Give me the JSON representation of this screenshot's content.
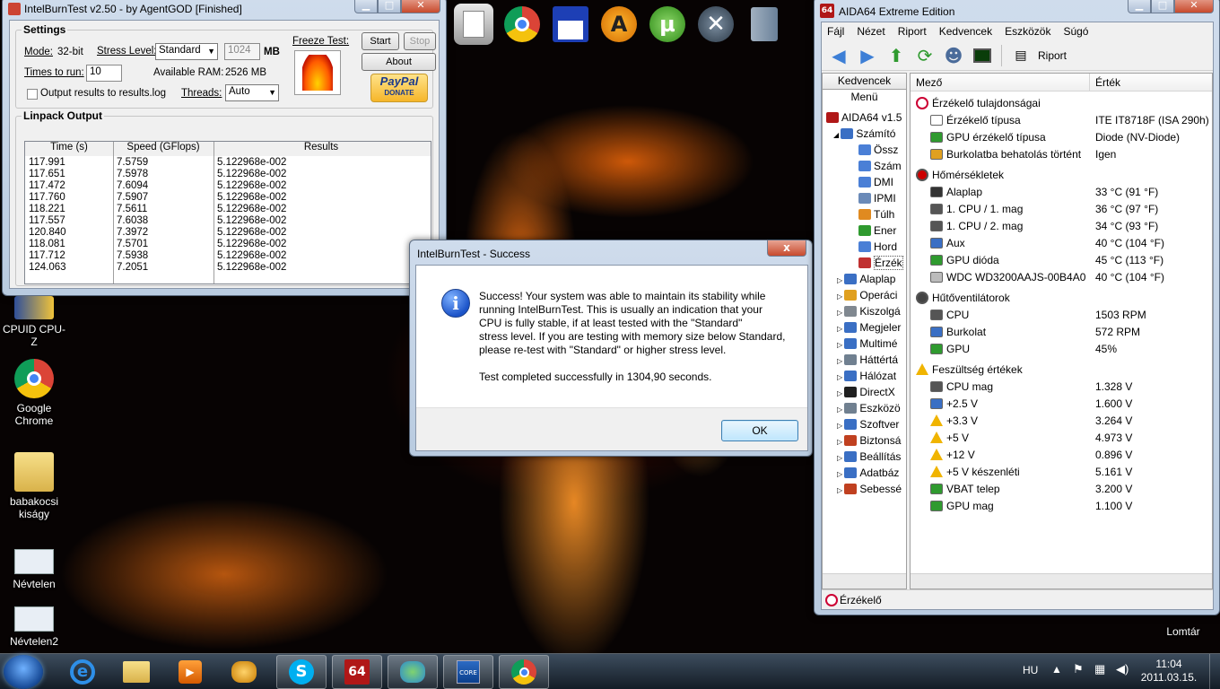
{
  "ibt": {
    "title": "IntelBurnTest v2.50 - by AgentGOD [Finished]",
    "settings_label": "Settings",
    "mode_label": "Mode:",
    "mode_value": "32-bit",
    "stress_label": "Stress Level:",
    "stress_value": "Standard",
    "mem_value": "1024",
    "mem_unit": "MB",
    "times_label": "Times to run:",
    "times_value": "10",
    "available_ram_label": "Available RAM:",
    "available_ram_value": "2526 MB",
    "output_checkbox": "Output results to results.log",
    "threads_label": "Threads:",
    "threads_value": "Auto",
    "freeze_label": "Freeze Test:",
    "start_label": "Start",
    "stop_label": "Stop",
    "about_label": "About",
    "paypal_label": "PayPal",
    "donate_label": "DONATE",
    "linpack_label": "Linpack Output",
    "columns": [
      "Time (s)",
      "Speed (GFlops)",
      "Results"
    ],
    "rows": [
      [
        "117.991",
        "7.5759",
        "5.122968e-002"
      ],
      [
        "117.651",
        "7.5978",
        "5.122968e-002"
      ],
      [
        "117.472",
        "7.6094",
        "5.122968e-002"
      ],
      [
        "117.760",
        "7.5907",
        "5.122968e-002"
      ],
      [
        "118.221",
        "7.5611",
        "5.122968e-002"
      ],
      [
        "117.557",
        "7.6038",
        "5.122968e-002"
      ],
      [
        "120.840",
        "7.3972",
        "5.122968e-002"
      ],
      [
        "118.081",
        "7.5701",
        "5.122968e-002"
      ],
      [
        "117.712",
        "7.5938",
        "5.122968e-002"
      ],
      [
        "124.063",
        "7.2051",
        "5.122968e-002"
      ]
    ]
  },
  "dialog": {
    "title": "IntelBurnTest - Success",
    "message": "Success! Your system was able to maintain its stability while\nrunning IntelBurnTest. This is usually an indication that your\nCPU is fully stable, if at least tested with the \"Standard\"\nstress level. If you are testing with memory size below Standard,\nplease re-test with \"Standard\" or higher stress level.\n\nTest completed successfully in 1304,90 seconds.",
    "ok_label": "OK",
    "close_glyph": "x"
  },
  "desktop_icons": [
    {
      "label": "CPUID CPU-Z"
    },
    {
      "label": "Google Chrome"
    },
    {
      "label": "babakocsi kiságy"
    },
    {
      "label": "Névtelen"
    },
    {
      "label": "Névtelen2"
    },
    {
      "label": "Lomtár"
    }
  ],
  "aida": {
    "title": "AIDA64 Extreme Edition",
    "menu": [
      "Fájl",
      "Nézet",
      "Riport",
      "Kedvencek",
      "Eszközök",
      "Súgó"
    ],
    "report_label": "Riport",
    "tabs": [
      "Kedvencek",
      "Menü"
    ],
    "tree": [
      "AIDA64 v1.5",
      "Számító",
      "Össz",
      "Szám",
      "DMI",
      "IPMI",
      "Túlh",
      "Ener",
      "Hord",
      "Érzék",
      "Alaplap",
      "Operáci",
      "Kiszolgá",
      "Megjeler",
      "Multimé",
      "Háttértá",
      "Hálózat",
      "DirectX",
      "Eszközö",
      "Szoftver",
      "Biztonsá",
      "Beállítás",
      "Adatbáz",
      "Sebessé"
    ],
    "col_field": "Mező",
    "col_value": "Érték",
    "sections": [
      {
        "title": "Érzékelő tulajdonságai",
        "items": [
          {
            "field": "Érzékelő típusa",
            "value": "ITE IT8718F  (ISA 290h)"
          },
          {
            "field": "GPU érzékelő típusa",
            "value": "Diode  (NV-Diode)"
          },
          {
            "field": "Burkolatba behatolás történt",
            "value": "Igen"
          }
        ]
      },
      {
        "title": "Hőmérsékletek",
        "items": [
          {
            "field": "Alaplap",
            "value": "33 °C  (91 °F)"
          },
          {
            "field": "1. CPU / 1. mag",
            "value": "36 °C  (97 °F)"
          },
          {
            "field": "1. CPU / 2. mag",
            "value": "34 °C  (93 °F)"
          },
          {
            "field": "Aux",
            "value": "40 °C  (104 °F)"
          },
          {
            "field": "GPU dióda",
            "value": "45 °C  (113 °F)"
          },
          {
            "field": "WDC WD3200AAJS-00B4A0",
            "value": "40 °C  (104 °F)"
          }
        ]
      },
      {
        "title": "Hűtőventilátorok",
        "items": [
          {
            "field": "CPU",
            "value": "1503 RPM"
          },
          {
            "field": "Burkolat",
            "value": "572 RPM"
          },
          {
            "field": "GPU",
            "value": "45%"
          }
        ]
      },
      {
        "title": "Feszültség értékek",
        "items": [
          {
            "field": "CPU mag",
            "value": "1.328 V"
          },
          {
            "field": "+2.5 V",
            "value": "1.600 V"
          },
          {
            "field": "+3.3 V",
            "value": "3.264 V"
          },
          {
            "field": "+5 V",
            "value": "4.973 V"
          },
          {
            "field": "+12 V",
            "value": "0.896 V"
          },
          {
            "field": "+5 V készenléti",
            "value": "5.161 V"
          },
          {
            "field": "VBAT telep",
            "value": "3.200 V"
          },
          {
            "field": "GPU mag",
            "value": "1.100 V"
          }
        ]
      }
    ],
    "status": "Érzékelő"
  },
  "taskbar": {
    "lang": "HU",
    "time": "11:04",
    "date": "2011.03.15."
  }
}
